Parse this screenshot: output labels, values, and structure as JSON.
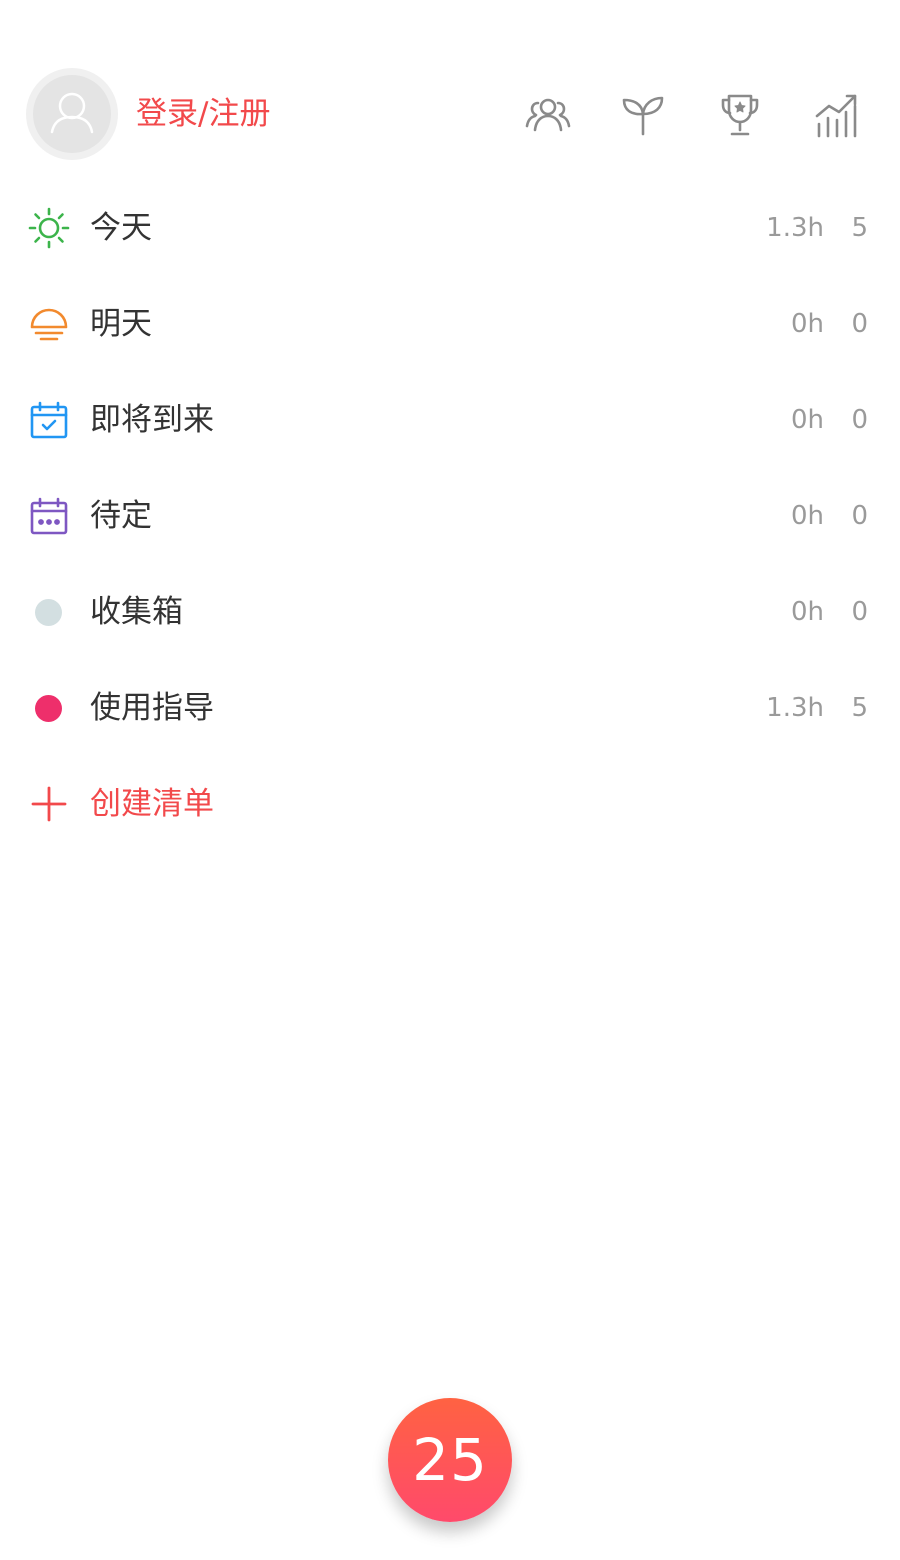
{
  "header": {
    "login_label": "登录/注册",
    "icons": [
      "team-icon",
      "sprout-icon",
      "trophy-icon",
      "stats-icon"
    ]
  },
  "menu": [
    {
      "label": "今天",
      "hours": "1.3h",
      "count": "5",
      "icon": "sun-icon",
      "color": "#3cb44b"
    },
    {
      "label": "明天",
      "hours": "0h",
      "count": "0",
      "icon": "sunset-icon",
      "color": "#f28a2e"
    },
    {
      "label": "即将到来",
      "hours": "0h",
      "count": "0",
      "icon": "calendar-check-icon",
      "color": "#2196f3"
    },
    {
      "label": "待定",
      "hours": "0h",
      "count": "0",
      "icon": "calendar-dots-icon",
      "color": "#7e57c2"
    },
    {
      "label": "收集箱",
      "hours": "0h",
      "count": "0",
      "icon": "gray-dot-icon",
      "color": "#d3dfe1"
    },
    {
      "label": "使用指导",
      "hours": "1.3h",
      "count": "5",
      "icon": "pink-dot-icon",
      "color": "#ee2f6b"
    }
  ],
  "create_list": {
    "label": "创建清单",
    "icon": "plus-icon",
    "color": "#f2494b"
  },
  "fab": {
    "value": "25"
  }
}
